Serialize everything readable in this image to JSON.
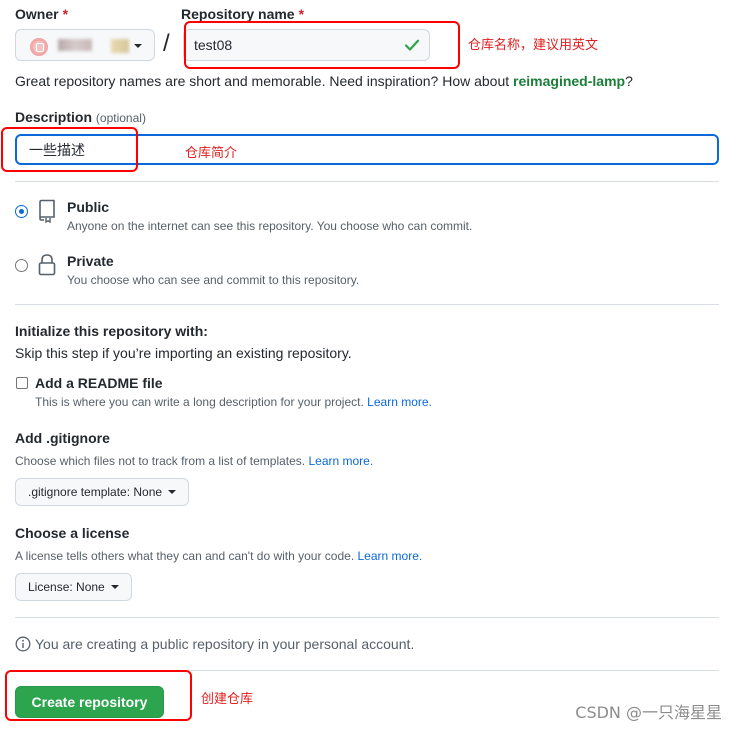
{
  "owner": {
    "label": "Owner",
    "required_mark": "*"
  },
  "repo_name": {
    "label": "Repository name",
    "required_mark": "*",
    "value": "test08",
    "status_icon": "check-icon"
  },
  "separator": "/",
  "annotations": {
    "repo_name_note": "仓库名称，建议用英文",
    "description_note": "仓库简介",
    "create_note": "创建仓库"
  },
  "name_hint": {
    "prefix": "Great repository names are short and memorable. Need inspiration? How about ",
    "suggestion": "reimagined-lamp",
    "suffix": "?"
  },
  "description": {
    "label": "Description",
    "optional": "(optional)",
    "value": "一些描述"
  },
  "visibility": [
    {
      "title": "Public",
      "desc": "Anyone on the internet can see this repository. You choose who can commit.",
      "icon": "repo-icon",
      "selected": true
    },
    {
      "title": "Private",
      "desc": "You choose who can see and commit to this repository.",
      "icon": "lock-icon",
      "selected": false
    }
  ],
  "init": {
    "title": "Initialize this repository with:",
    "subtitle": "Skip this step if you’re importing an existing repository.",
    "readme": {
      "title": "Add a README file",
      "desc": "This is where you can write a long description for your project.",
      "link": "Learn more.",
      "checked": false
    }
  },
  "gitignore": {
    "title": "Add .gitignore",
    "desc": "Choose which files not to track from a list of templates.",
    "link": "Learn more.",
    "button": ".gitignore template: None"
  },
  "license": {
    "title": "Choose a license",
    "desc": "A license tells others what they can and can't do with your code.",
    "link": "Learn more.",
    "button": "License: None"
  },
  "notice": {
    "icon": "info-icon",
    "text": "You are creating a public repository in your personal account."
  },
  "create_button": "Create repository",
  "watermark": "CSDN @一只海星星",
  "colors": {
    "accent": "#0969da",
    "success": "#2da44e",
    "annotation": "#ff0000"
  }
}
